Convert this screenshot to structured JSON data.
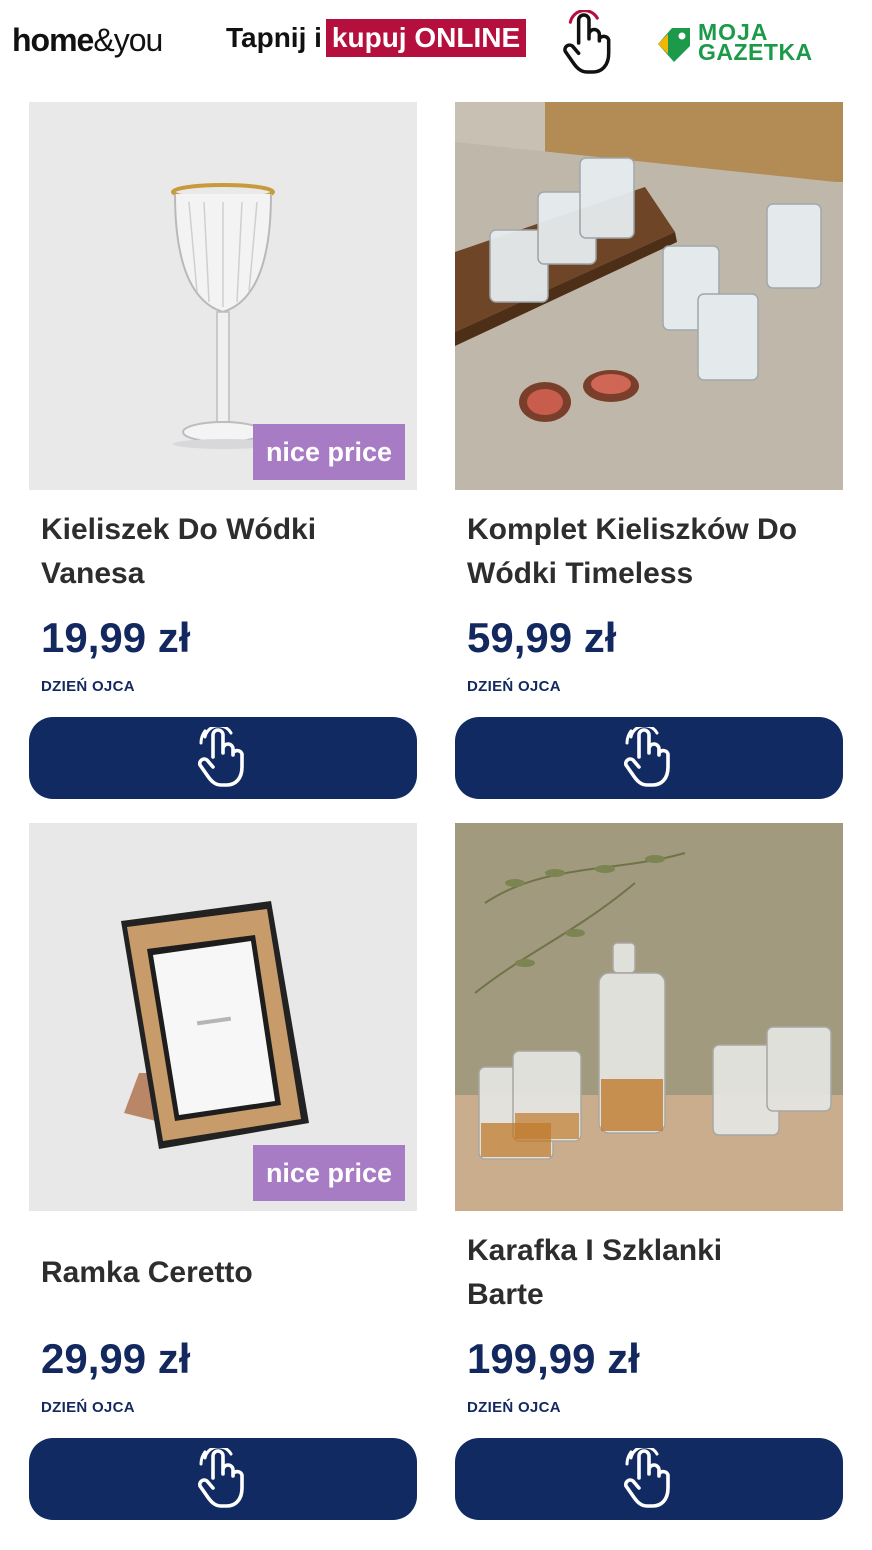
{
  "header": {
    "brand_bold": "home",
    "brand_light": "&you",
    "cta_prefix": "Tapnij i",
    "cta_highlight": "kupuj ONLINE",
    "gazetka_line1": "MOJA",
    "gazetka_line2": "GAZETKA"
  },
  "colors": {
    "price": "#12285e",
    "button": "#112a62",
    "badge": "#a77cc4",
    "highlight": "#b5103d",
    "gazetka": "#1c9a4a"
  },
  "products": [
    {
      "title_line1": "Kieliszek Do Wódki",
      "title_line2": "Vanesa",
      "price": "19,99 zł",
      "tag": "DZIEŃ OJCA",
      "badge": "nice price",
      "icon": "pointer-hand-icon"
    },
    {
      "title_line1": "Komplet Kieliszków Do",
      "title_line2": "Wódki Timeless",
      "price": "59,99 zł",
      "tag": "DZIEŃ OJCA",
      "badge": "",
      "icon": "pointer-hand-icon"
    },
    {
      "title_line1": "Ramka Ceretto",
      "title_line2": "",
      "price": "29,99 zł",
      "tag": "DZIEŃ OJCA",
      "badge": "nice price",
      "icon": "pointer-hand-icon"
    },
    {
      "title_line1": "Karafka I Szklanki",
      "title_line2": "Barte",
      "price": "199,99 zł",
      "tag": "DZIEŃ OJCA",
      "badge": "",
      "icon": "pointer-hand-icon"
    }
  ]
}
